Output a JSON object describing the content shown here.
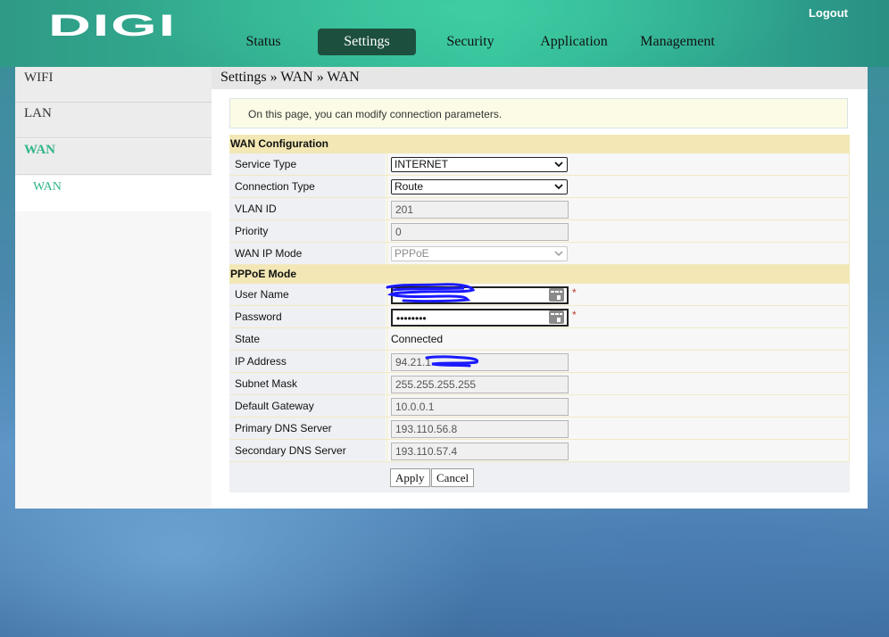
{
  "header": {
    "logo_text": "DIGI",
    "logout_label": "Logout",
    "nav": [
      {
        "label": "Status",
        "active": false
      },
      {
        "label": "Settings",
        "active": true
      },
      {
        "label": "Security",
        "active": false
      },
      {
        "label": "Application",
        "active": false
      },
      {
        "label": "Management",
        "active": false
      }
    ]
  },
  "sidebar": {
    "items": [
      {
        "label": "WIFI"
      },
      {
        "label": "LAN"
      },
      {
        "label": "WAN",
        "active_group": true
      }
    ],
    "subitems": [
      {
        "label": "WAN",
        "active": true
      }
    ]
  },
  "breadcrumb": "Settings » WAN » WAN",
  "info_text": "On this page, you can modify connection parameters.",
  "wan_config": {
    "section_title": "WAN Configuration",
    "service_type": {
      "label": "Service Type",
      "value": "INTERNET"
    },
    "connection_type": {
      "label": "Connection Type",
      "value": "Route"
    },
    "vlan_id": {
      "label": "VLAN ID",
      "value": "201"
    },
    "priority": {
      "label": "Priority",
      "value": "0"
    },
    "wan_ip_mode": {
      "label": "WAN IP Mode",
      "value": "PPPoE"
    }
  },
  "pppoe": {
    "section_title": "PPPoE Mode",
    "user_name": {
      "label": "User Name",
      "value": ""
    },
    "password": {
      "label": "Password",
      "value": "••••••••"
    },
    "state": {
      "label": "State",
      "value": "Connected"
    },
    "ip_address": {
      "label": "IP Address",
      "value": "94.21.1"
    },
    "subnet_mask": {
      "label": "Subnet Mask",
      "value": "255.255.255.255"
    },
    "default_gateway": {
      "label": "Default Gateway",
      "value": "10.0.0.1"
    },
    "primary_dns": {
      "label": "Primary DNS Server",
      "value": "193.110.56.8"
    },
    "secondary_dns": {
      "label": "Secondary DNS Server",
      "value": "193.110.57.4"
    },
    "required_marker": "*"
  },
  "buttons": {
    "apply": "Apply",
    "cancel": "Cancel"
  },
  "icons": {
    "chevron": "chevron-down-icon",
    "password_manager": "key-icon"
  },
  "colors": {
    "accent_green": "#2fb58a",
    "active_tab_bg": "#1d4f3f",
    "section_header_bg": "#f3e8b5",
    "redaction_blue": "#1a1aff"
  }
}
